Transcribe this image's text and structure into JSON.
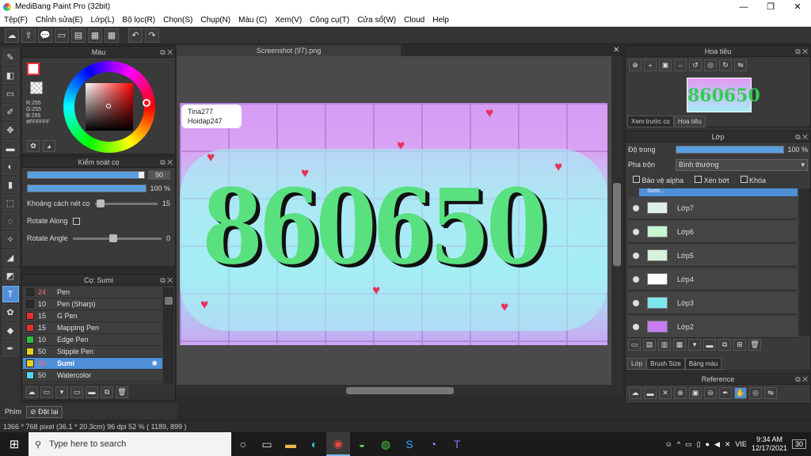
{
  "window": {
    "title": "MediBang Paint Pro (32bit)",
    "minimize": "—",
    "maximize": "❐",
    "close": "✕"
  },
  "menu": [
    "Tệp(F)",
    "Chỉnh sửa(E)",
    "Lớp(L)",
    "Bộ lọc(R)",
    "Chọn(S)",
    "Chụp(N)",
    "Màu (C)",
    "Xem(V)",
    "Công cụ(T)",
    "Cửa sổ(W)",
    "Cloud",
    "Help"
  ],
  "toolbar_icons": [
    "☁",
    "⇪",
    "💬",
    "▭",
    "▤",
    "▦",
    "▦",
    "↶",
    "↷"
  ],
  "left_tools": [
    "✎",
    "◧",
    "▭",
    "✐",
    "✥",
    "▬",
    "◐",
    "▮",
    "⬚",
    "◌",
    "✧",
    "◢",
    "◩",
    "T",
    "✿",
    "◆",
    "✒"
  ],
  "color_panel": {
    "title": "Màu",
    "r": "R:255",
    "g": "G:255",
    "b": "B:255",
    "hex": "#FFFFFF"
  },
  "brush_control": {
    "title": "Kiểm soát cọ",
    "size_value": "90",
    "size_fraction": 0.95,
    "opacity_value": "100 %",
    "opacity_fraction": 1.0,
    "spacing_label": "Khoảng cách nét cọ",
    "spacing_value": "15",
    "rotate_along_label": "Rotate Along",
    "rotate_angle_label": "Rotate Angle",
    "rotate_angle_value": "0"
  },
  "brush_panel": {
    "title": "Cọ: Sumi",
    "items": [
      {
        "size": "24",
        "name": "Pen",
        "color": "#2b2b2b",
        "size_color": "#ff6a6a"
      },
      {
        "size": "10",
        "name": "Pen (Sharp)",
        "color": "#2b2b2b",
        "size_color": "#dddddd"
      },
      {
        "size": "15",
        "name": "G Pen",
        "color": "#e53030",
        "size_color": "#dddddd"
      },
      {
        "size": "15",
        "name": "Mapping Pen",
        "color": "#e53030",
        "size_color": "#dddddd"
      },
      {
        "size": "10",
        "name": "Edge Pen",
        "color": "#2fbf3f",
        "size_color": "#dddddd"
      },
      {
        "size": "50",
        "name": "Stipple Pen",
        "color": "#e8d020",
        "size_color": "#dddddd"
      },
      {
        "size": "90",
        "name": "Sumi",
        "color": "#e8d020",
        "size_color": "#ff6a6a",
        "selected": true
      },
      {
        "size": "50",
        "name": "Watercolor",
        "color": "#5ad2ee",
        "size_color": "#dddddd"
      }
    ],
    "gear": "✱"
  },
  "document": {
    "tab": "Screenshot (97).png",
    "close": "✕",
    "tag_line1": "Tina277",
    "tag_line2": "Hoidap247",
    "number": "860650"
  },
  "navigator": {
    "title": "Hoa tiêu",
    "tab1": "Xem trước cọ",
    "tab2": "Hoa tiêu",
    "thumb_text": "860650"
  },
  "layer_panel": {
    "title": "Lớp",
    "opacity_label": "Độ trong",
    "opacity_value": "100 %",
    "blend_label": "Pha trộn",
    "blend_value": "Bình thường",
    "protect_alpha": "Bảo vệ alpha",
    "clip": "Xén bớt",
    "lock": "Khóa",
    "partial_label": "Sumi...",
    "layers": [
      {
        "name": "Lớp7",
        "thumb": "#dff0e8"
      },
      {
        "name": "Lớp6",
        "thumb": "#c8f5d2"
      },
      {
        "name": "Lớp5",
        "thumb": "#d6f2dd"
      },
      {
        "name": "Lớp4",
        "thumb": "#ffffff"
      },
      {
        "name": "Lớp3",
        "thumb": "#7fe6f0"
      },
      {
        "name": "Lớp2",
        "thumb": "#c67cf0"
      }
    ],
    "tabs": [
      "Lớp",
      "Brush Size",
      "Bảng màu"
    ]
  },
  "reference_panel": {
    "title": "Reference"
  },
  "bottom_tool": {
    "label": "Phím",
    "reset": "Đặt lại"
  },
  "status": "1366 * 768 pixel   (36.1 * 20.3cm)   96 dpi   52 %   ( 1189, 899 )",
  "taskbar": {
    "search_placeholder": "Type here to search",
    "lang": "VIE",
    "time": "9:34 AM",
    "date": "12/17/2021",
    "notif": "30"
  }
}
